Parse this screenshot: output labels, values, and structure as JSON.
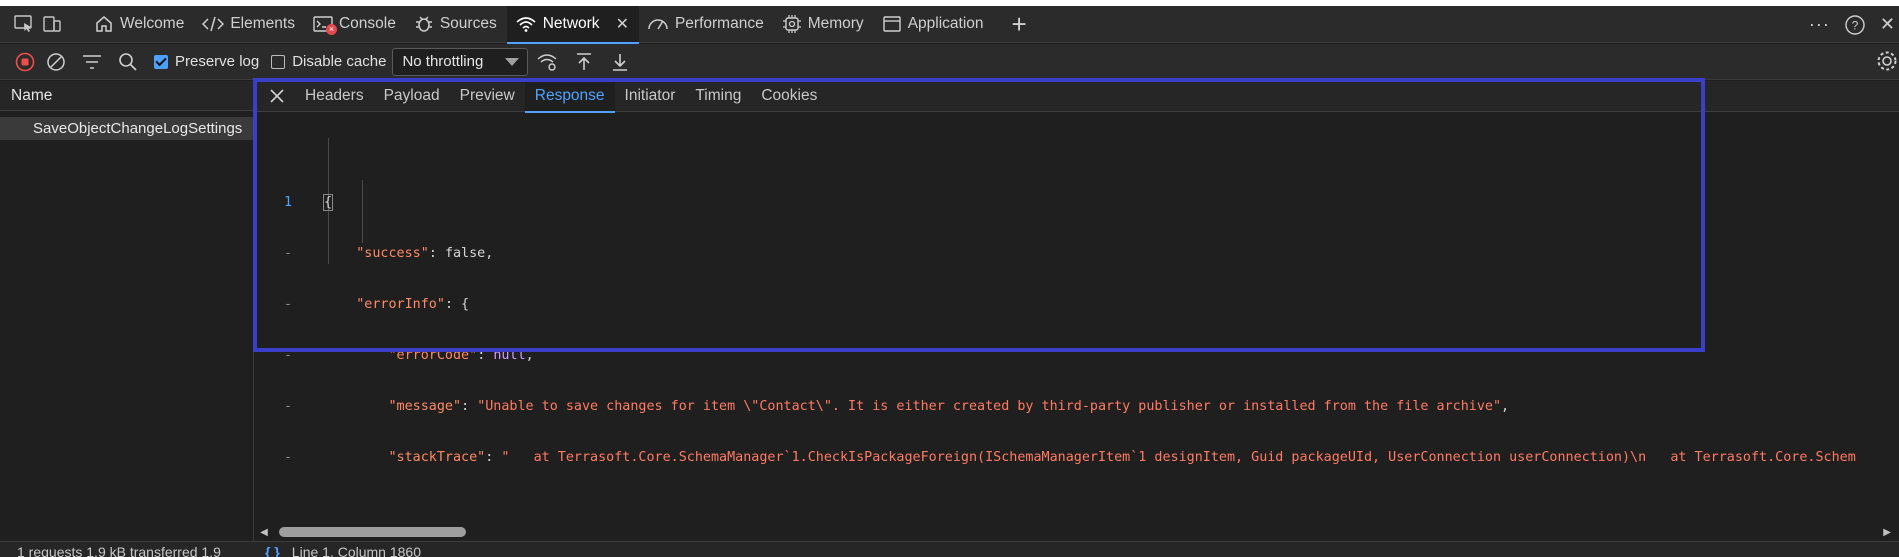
{
  "tabbar": {
    "tabs": [
      {
        "label": "Welcome",
        "icon": "home-icon"
      },
      {
        "label": "Elements",
        "icon": "code-icon"
      },
      {
        "label": "Console",
        "icon": "console-icon"
      },
      {
        "label": "Sources",
        "icon": "bug-icon"
      },
      {
        "label": "Network",
        "icon": "wifi-icon",
        "active": true
      },
      {
        "label": "Performance",
        "icon": "gauge-icon"
      },
      {
        "label": "Memory",
        "icon": "chip-icon"
      },
      {
        "label": "Application",
        "icon": "window-icon"
      }
    ]
  },
  "toolbar": {
    "preserve_log_label": "Preserve log",
    "preserve_log_checked": true,
    "disable_cache_label": "Disable cache",
    "disable_cache_checked": false,
    "throttling_value": "No throttling"
  },
  "requests": {
    "header": "Name",
    "items": [
      {
        "name": "SaveObjectChangeLogSettings"
      }
    ]
  },
  "detail": {
    "tabs": [
      "Headers",
      "Payload",
      "Preview",
      "Response",
      "Initiator",
      "Timing",
      "Cookies"
    ],
    "active_tab": "Response",
    "gutter": [
      "1",
      "-",
      "-",
      "-",
      "-",
      "-",
      "-",
      "-"
    ],
    "response": {
      "success_key": "\"success\"",
      "success_value": "false",
      "errorInfo_key": "\"errorInfo\"",
      "errorCode_key": "\"errorCode\"",
      "errorCode_value": "null",
      "message_key": "\"message\"",
      "message_value": "\"Unable to save changes for item \\\"Contact\\\". It is either created by third-party publisher or installed from the file archive\"",
      "stackTrace_key": "\"stackTrace\"",
      "stackTrace_value": "\"   at Terrasoft.Core.SchemaManager`1.CheckIsPackageForeign(ISchemaManagerItem`1 designItem, Guid packageUId, UserConnection userConnection)\\n   at Terrasoft.Core.Schem"
    }
  },
  "status": {
    "summary": "1 requests   1.9 kB transferred   1.9",
    "braces": "{ }",
    "position": "Line 1, Column 1860"
  },
  "colors": {
    "accent": "#4fa3ff",
    "highlight_box": "#3a3fc9",
    "string": "#ff7b63",
    "keyword": "#d59cff"
  }
}
